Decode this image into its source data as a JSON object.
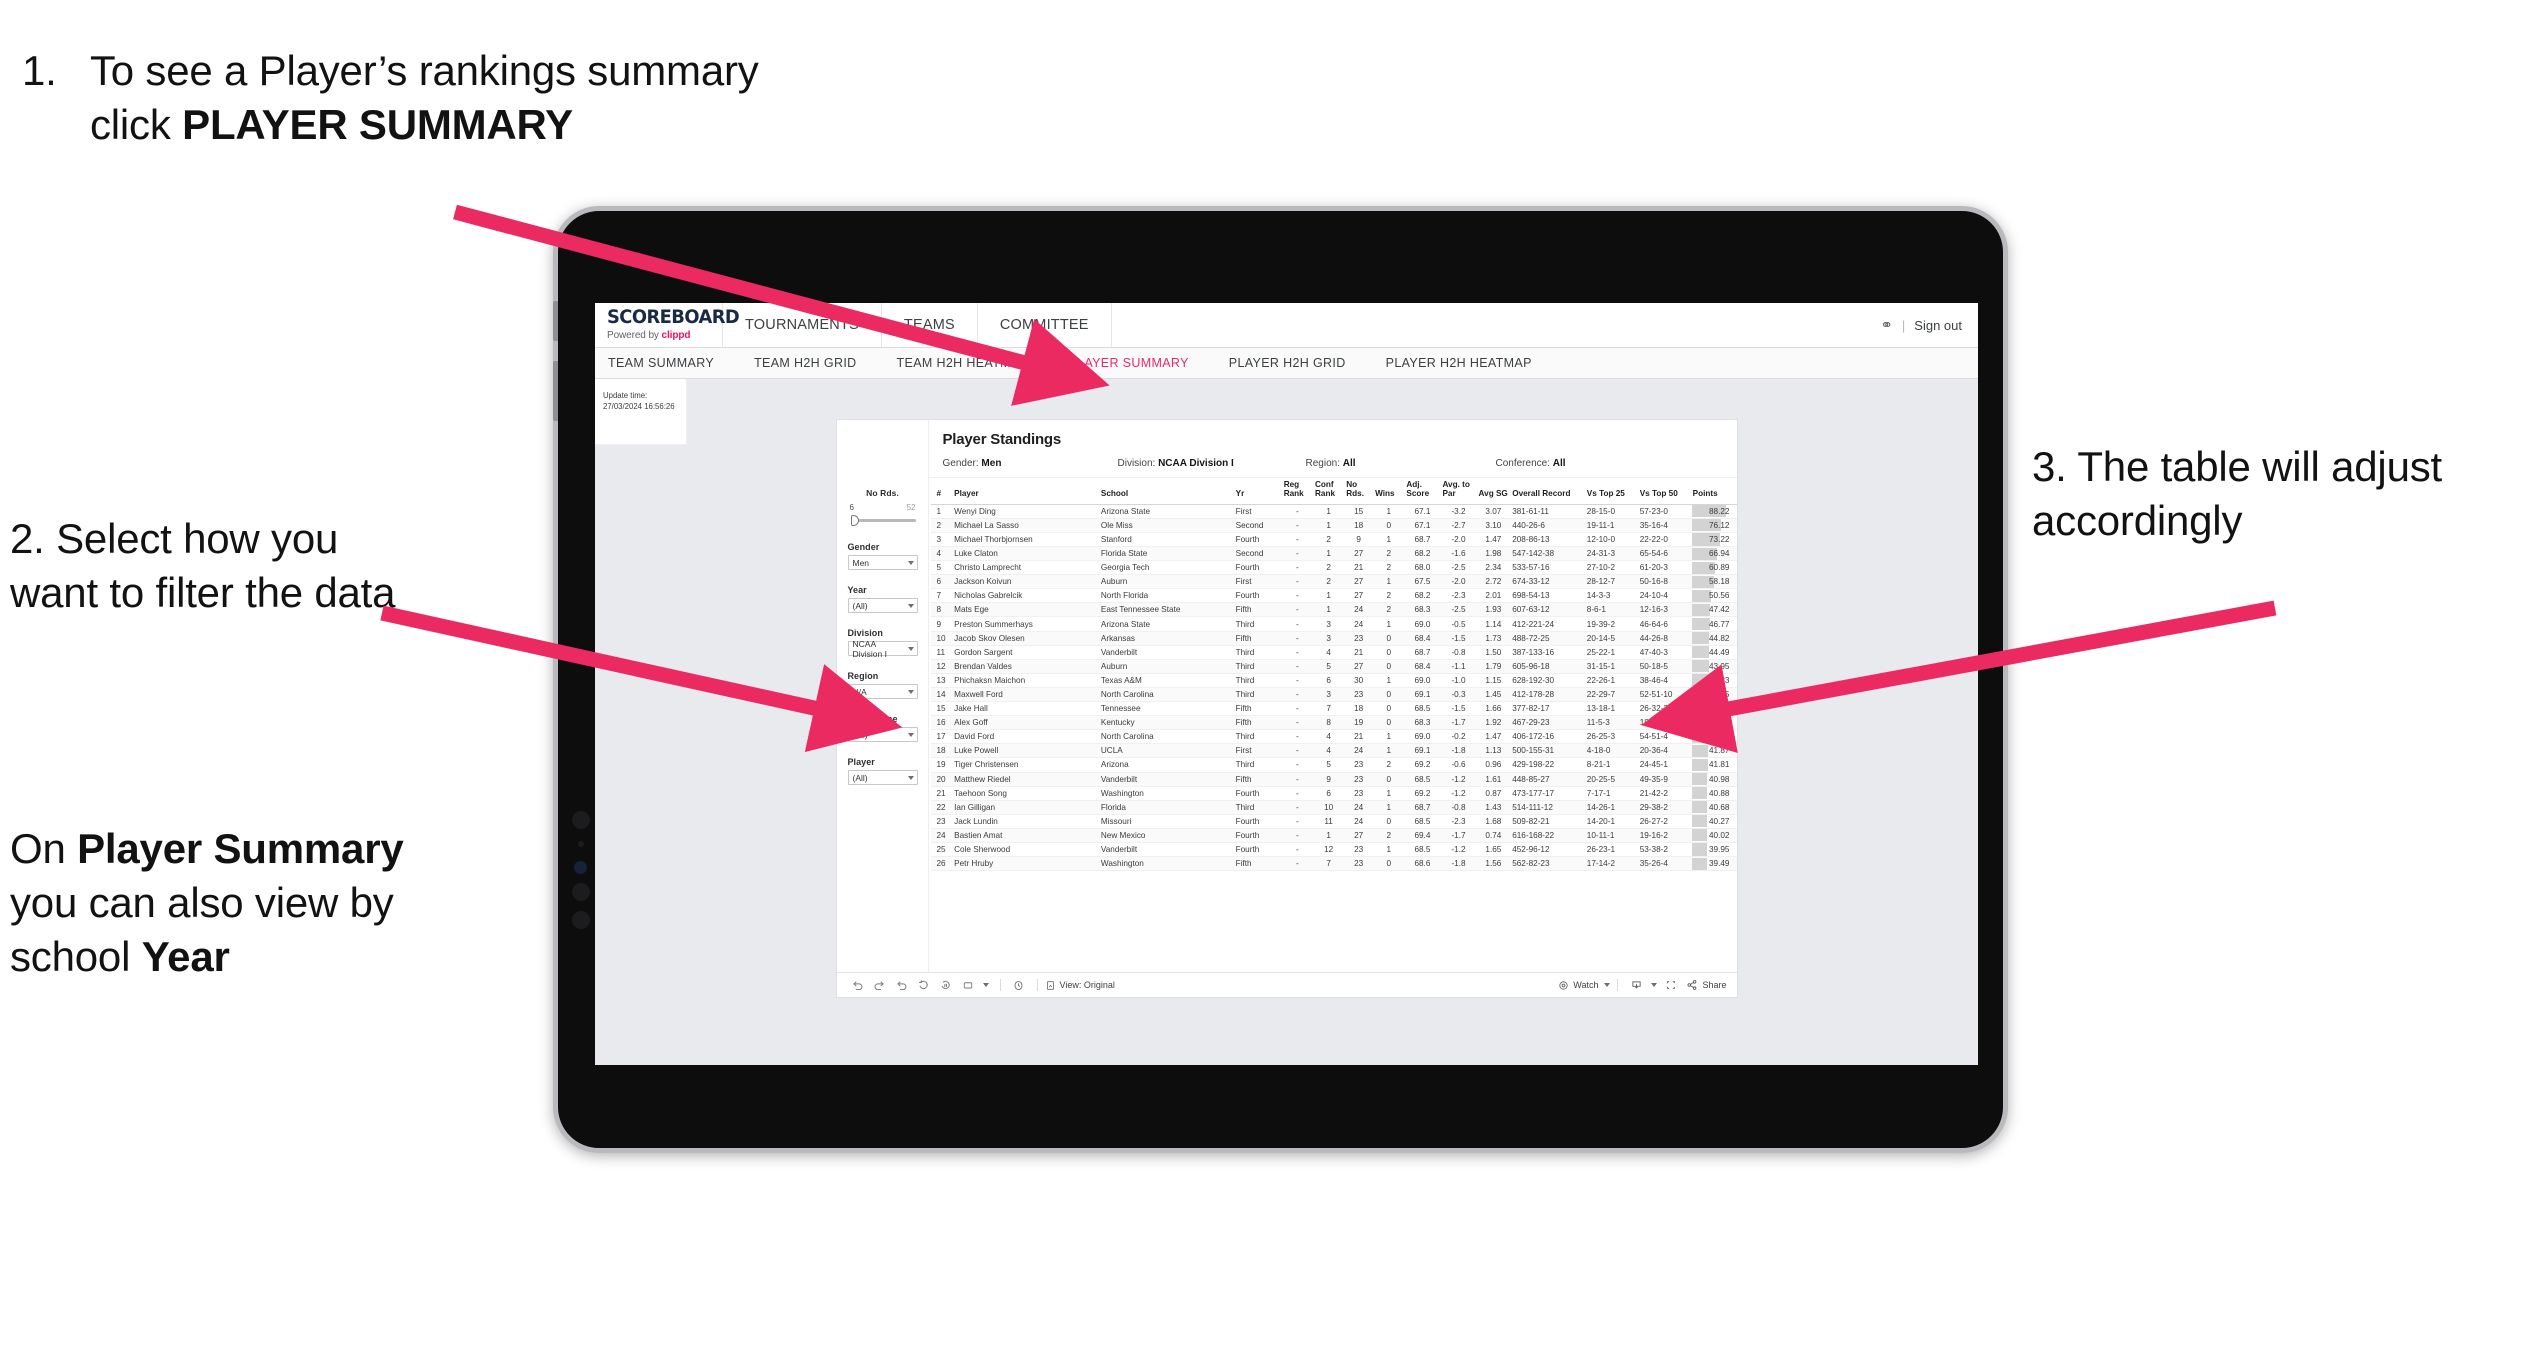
{
  "annotations": {
    "step1": {
      "number": "1.",
      "text_before": "To see a Player’s rankings summary click ",
      "bold": "PLAYER SUMMARY"
    },
    "step2": {
      "text": "2. Select how you want to filter the data"
    },
    "step2b": {
      "pre": "On ",
      "bold1": "Player Summary",
      "mid": " you can also view by school ",
      "bold2": "Year"
    },
    "step3": {
      "text": "3. The table will adjust accordingly"
    },
    "arrow_color": "#ec2a62"
  },
  "app": {
    "logo": {
      "main": "SCOREBOARD",
      "powered": "Powered by",
      "brand": "clippd"
    },
    "top_nav": [
      "TOURNAMENTS",
      "TEAMS",
      "COMMITTEE"
    ],
    "account_icon": "person-icon",
    "divider": "|",
    "sign_out": "Sign out",
    "sub_nav": [
      {
        "label": "TEAM SUMMARY",
        "active": false
      },
      {
        "label": "TEAM H2H GRID",
        "active": false
      },
      {
        "label": "TEAM H2H HEATMAP",
        "active": false
      },
      {
        "label": "PLAYER SUMMARY",
        "active": true
      },
      {
        "label": "PLAYER H2H GRID",
        "active": false
      },
      {
        "label": "PLAYER H2H HEATMAP",
        "active": false
      }
    ],
    "active_tab_color": "#ea2a68"
  },
  "viz": {
    "update_time_label": "Update time:",
    "update_time_value": "27/03/2024 16:56:26",
    "title": "Player Standings",
    "meta": [
      {
        "label": "Gender:",
        "value": "Men"
      },
      {
        "label": "Division:",
        "value": "NCAA Division I"
      },
      {
        "label": "Region:",
        "value": "All"
      },
      {
        "label": "Conference:",
        "value": "All"
      }
    ],
    "filters": {
      "slider": {
        "label": "No Rds.",
        "min": "6",
        "max": "52"
      },
      "selects": [
        {
          "label": "Gender",
          "value": "Men"
        },
        {
          "label": "Year",
          "value": "(All)"
        },
        {
          "label": "Division",
          "value": "NCAA Division I"
        },
        {
          "label": "Region",
          "value": "N/A"
        },
        {
          "label": "Conference",
          "value": "(All)"
        },
        {
          "label": "Player",
          "value": "(All)"
        }
      ]
    },
    "toolbar": {
      "undo_icon": "undo-icon",
      "redo_icon": "redo-icon",
      "revert_icon": "revert-icon",
      "refresh_icon": "refresh-icon",
      "pause_icon": "pause-icon",
      "device_icon": "device-icon",
      "history_icon": "history-icon",
      "view_label": "View: Original",
      "watch_label": "Watch",
      "download_icon": "download-icon",
      "fullscreen_icon": "fullscreen-icon",
      "share_label": "Share"
    }
  },
  "table": {
    "columns": [
      {
        "key": "rank",
        "label": "#"
      },
      {
        "key": "player",
        "label": "Player"
      },
      {
        "key": "school",
        "label": "School"
      },
      {
        "key": "yr",
        "label": "Yr"
      },
      {
        "key": "reg_rank",
        "label": "Reg Rank"
      },
      {
        "key": "conf_rank",
        "label": "Conf Rank"
      },
      {
        "key": "no_rds",
        "label": "No Rds."
      },
      {
        "key": "wins",
        "label": "Wins"
      },
      {
        "key": "adj_score",
        "label": "Adj. Score"
      },
      {
        "key": "avg_to_par",
        "label": "Avg. to Par"
      },
      {
        "key": "avg_sg",
        "label": "Avg SG"
      },
      {
        "key": "overall_record",
        "label": "Overall Record"
      },
      {
        "key": "vs_top_25",
        "label": "Vs Top 25"
      },
      {
        "key": "vs_top_50",
        "label": "Vs Top 50"
      },
      {
        "key": "points",
        "label": "Points"
      }
    ],
    "points_max": 88.22,
    "rows": [
      {
        "rank": "1",
        "player": "Wenyi Ding",
        "school": "Arizona State",
        "yr": "First",
        "reg_rank": "-",
        "conf_rank": "1",
        "no_rds": "15",
        "wins": "1",
        "adj_score": "67.1",
        "avg_to_par": "-3.2",
        "avg_sg": "3.07",
        "overall_record": "381-61-11",
        "vs_top_25": "28-15-0",
        "vs_top_50": "57-23-0",
        "points": "88.22"
      },
      {
        "rank": "2",
        "player": "Michael La Sasso",
        "school": "Ole Miss",
        "yr": "Second",
        "reg_rank": "-",
        "conf_rank": "1",
        "no_rds": "18",
        "wins": "0",
        "adj_score": "67.1",
        "avg_to_par": "-2.7",
        "avg_sg": "3.10",
        "overall_record": "440-26-6",
        "vs_top_25": "19-11-1",
        "vs_top_50": "35-16-4",
        "points": "76.12"
      },
      {
        "rank": "3",
        "player": "Michael Thorbjornsen",
        "school": "Stanford",
        "yr": "Fourth",
        "reg_rank": "-",
        "conf_rank": "2",
        "no_rds": "9",
        "wins": "1",
        "adj_score": "68.7",
        "avg_to_par": "-2.0",
        "avg_sg": "1.47",
        "overall_record": "208-86-13",
        "vs_top_25": "12-10-0",
        "vs_top_50": "22-22-0",
        "points": "73.22"
      },
      {
        "rank": "4",
        "player": "Luke Claton",
        "school": "Florida State",
        "yr": "Second",
        "reg_rank": "-",
        "conf_rank": "1",
        "no_rds": "27",
        "wins": "2",
        "adj_score": "68.2",
        "avg_to_par": "-1.6",
        "avg_sg": "1.98",
        "overall_record": "547-142-38",
        "vs_top_25": "24-31-3",
        "vs_top_50": "65-54-6",
        "points": "66.94"
      },
      {
        "rank": "5",
        "player": "Christo Lamprecht",
        "school": "Georgia Tech",
        "yr": "Fourth",
        "reg_rank": "-",
        "conf_rank": "2",
        "no_rds": "21",
        "wins": "2",
        "adj_score": "68.0",
        "avg_to_par": "-2.5",
        "avg_sg": "2.34",
        "overall_record": "533-57-16",
        "vs_top_25": "27-10-2",
        "vs_top_50": "61-20-3",
        "points": "60.89"
      },
      {
        "rank": "6",
        "player": "Jackson Koivun",
        "school": "Auburn",
        "yr": "First",
        "reg_rank": "-",
        "conf_rank": "2",
        "no_rds": "27",
        "wins": "1",
        "adj_score": "67.5",
        "avg_to_par": "-2.0",
        "avg_sg": "2.72",
        "overall_record": "674-33-12",
        "vs_top_25": "28-12-7",
        "vs_top_50": "50-16-8",
        "points": "58.18"
      },
      {
        "rank": "7",
        "player": "Nicholas Gabrelcik",
        "school": "North Florida",
        "yr": "Fourth",
        "reg_rank": "-",
        "conf_rank": "1",
        "no_rds": "27",
        "wins": "2",
        "adj_score": "68.2",
        "avg_to_par": "-2.3",
        "avg_sg": "2.01",
        "overall_record": "698-54-13",
        "vs_top_25": "14-3-3",
        "vs_top_50": "24-10-4",
        "points": "50.56"
      },
      {
        "rank": "8",
        "player": "Mats Ege",
        "school": "East Tennessee State",
        "yr": "Fifth",
        "reg_rank": "-",
        "conf_rank": "1",
        "no_rds": "24",
        "wins": "2",
        "adj_score": "68.3",
        "avg_to_par": "-2.5",
        "avg_sg": "1.93",
        "overall_record": "607-63-12",
        "vs_top_25": "8-6-1",
        "vs_top_50": "12-16-3",
        "points": "47.42"
      },
      {
        "rank": "9",
        "player": "Preston Summerhays",
        "school": "Arizona State",
        "yr": "Third",
        "reg_rank": "-",
        "conf_rank": "3",
        "no_rds": "24",
        "wins": "1",
        "adj_score": "69.0",
        "avg_to_par": "-0.5",
        "avg_sg": "1.14",
        "overall_record": "412-221-24",
        "vs_top_25": "19-39-2",
        "vs_top_50": "46-64-6",
        "points": "46.77"
      },
      {
        "rank": "10",
        "player": "Jacob Skov Olesen",
        "school": "Arkansas",
        "yr": "Fifth",
        "reg_rank": "-",
        "conf_rank": "3",
        "no_rds": "23",
        "wins": "0",
        "adj_score": "68.4",
        "avg_to_par": "-1.5",
        "avg_sg": "1.73",
        "overall_record": "488-72-25",
        "vs_top_25": "20-14-5",
        "vs_top_50": "44-26-8",
        "points": "44.82"
      },
      {
        "rank": "11",
        "player": "Gordon Sargent",
        "school": "Vanderbilt",
        "yr": "Third",
        "reg_rank": "-",
        "conf_rank": "4",
        "no_rds": "21",
        "wins": "0",
        "adj_score": "68.7",
        "avg_to_par": "-0.8",
        "avg_sg": "1.50",
        "overall_record": "387-133-16",
        "vs_top_25": "25-22-1",
        "vs_top_50": "47-40-3",
        "points": "44.49"
      },
      {
        "rank": "12",
        "player": "Brendan Valdes",
        "school": "Auburn",
        "yr": "Third",
        "reg_rank": "-",
        "conf_rank": "5",
        "no_rds": "27",
        "wins": "0",
        "adj_score": "68.4",
        "avg_to_par": "-1.1",
        "avg_sg": "1.79",
        "overall_record": "605-96-18",
        "vs_top_25": "31-15-1",
        "vs_top_50": "50-18-5",
        "points": "43.95"
      },
      {
        "rank": "13",
        "player": "Phichaksn Maichon",
        "school": "Texas A&M",
        "yr": "Third",
        "reg_rank": "-",
        "conf_rank": "6",
        "no_rds": "30",
        "wins": "1",
        "adj_score": "69.0",
        "avg_to_par": "-1.0",
        "avg_sg": "1.15",
        "overall_record": "628-192-30",
        "vs_top_25": "22-26-1",
        "vs_top_50": "38-46-4",
        "points": "43.83"
      },
      {
        "rank": "14",
        "player": "Maxwell Ford",
        "school": "North Carolina",
        "yr": "Third",
        "reg_rank": "-",
        "conf_rank": "3",
        "no_rds": "23",
        "wins": "0",
        "adj_score": "69.1",
        "avg_to_par": "-0.3",
        "avg_sg": "1.45",
        "overall_record": "412-178-28",
        "vs_top_25": "22-29-7",
        "vs_top_50": "52-51-10",
        "points": "42.75"
      },
      {
        "rank": "15",
        "player": "Jake Hall",
        "school": "Tennessee",
        "yr": "Fifth",
        "reg_rank": "-",
        "conf_rank": "7",
        "no_rds": "18",
        "wins": "0",
        "adj_score": "68.5",
        "avg_to_par": "-1.5",
        "avg_sg": "1.66",
        "overall_record": "377-82-17",
        "vs_top_25": "13-18-1",
        "vs_top_50": "26-32-2",
        "points": "42.55"
      },
      {
        "rank": "16",
        "player": "Alex Goff",
        "school": "Kentucky",
        "yr": "Fifth",
        "reg_rank": "-",
        "conf_rank": "8",
        "no_rds": "19",
        "wins": "0",
        "adj_score": "68.3",
        "avg_to_par": "-1.7",
        "avg_sg": "1.92",
        "overall_record": "467-29-23",
        "vs_top_25": "11-5-3",
        "vs_top_50": "18-7-3",
        "points": "42.54"
      },
      {
        "rank": "17",
        "player": "David Ford",
        "school": "North Carolina",
        "yr": "Third",
        "reg_rank": "-",
        "conf_rank": "4",
        "no_rds": "21",
        "wins": "1",
        "adj_score": "69.0",
        "avg_to_par": "-0.2",
        "avg_sg": "1.47",
        "overall_record": "406-172-16",
        "vs_top_25": "26-25-3",
        "vs_top_50": "54-51-4",
        "points": "42.35"
      },
      {
        "rank": "18",
        "player": "Luke Powell",
        "school": "UCLA",
        "yr": "First",
        "reg_rank": "-",
        "conf_rank": "4",
        "no_rds": "24",
        "wins": "1",
        "adj_score": "69.1",
        "avg_to_par": "-1.8",
        "avg_sg": "1.13",
        "overall_record": "500-155-31",
        "vs_top_25": "4-18-0",
        "vs_top_50": "20-36-4",
        "points": "41.87"
      },
      {
        "rank": "19",
        "player": "Tiger Christensen",
        "school": "Arizona",
        "yr": "Third",
        "reg_rank": "-",
        "conf_rank": "5",
        "no_rds": "23",
        "wins": "2",
        "adj_score": "69.2",
        "avg_to_par": "-0.6",
        "avg_sg": "0.96",
        "overall_record": "429-198-22",
        "vs_top_25": "8-21-1",
        "vs_top_50": "24-45-1",
        "points": "41.81"
      },
      {
        "rank": "20",
        "player": "Matthew Riedel",
        "school": "Vanderbilt",
        "yr": "Fifth",
        "reg_rank": "-",
        "conf_rank": "9",
        "no_rds": "23",
        "wins": "0",
        "adj_score": "68.5",
        "avg_to_par": "-1.2",
        "avg_sg": "1.61",
        "overall_record": "448-85-27",
        "vs_top_25": "20-25-5",
        "vs_top_50": "49-35-9",
        "points": "40.98"
      },
      {
        "rank": "21",
        "player": "Taehoon Song",
        "school": "Washington",
        "yr": "Fourth",
        "reg_rank": "-",
        "conf_rank": "6",
        "no_rds": "23",
        "wins": "1",
        "adj_score": "69.2",
        "avg_to_par": "-1.2",
        "avg_sg": "0.87",
        "overall_record": "473-177-17",
        "vs_top_25": "7-17-1",
        "vs_top_50": "21-42-2",
        "points": "40.88"
      },
      {
        "rank": "22",
        "player": "Ian Gilligan",
        "school": "Florida",
        "yr": "Third",
        "reg_rank": "-",
        "conf_rank": "10",
        "no_rds": "24",
        "wins": "1",
        "adj_score": "68.7",
        "avg_to_par": "-0.8",
        "avg_sg": "1.43",
        "overall_record": "514-111-12",
        "vs_top_25": "14-26-1",
        "vs_top_50": "29-38-2",
        "points": "40.68"
      },
      {
        "rank": "23",
        "player": "Jack Lundin",
        "school": "Missouri",
        "yr": "Fourth",
        "reg_rank": "-",
        "conf_rank": "11",
        "no_rds": "24",
        "wins": "0",
        "adj_score": "68.5",
        "avg_to_par": "-2.3",
        "avg_sg": "1.68",
        "overall_record": "509-82-21",
        "vs_top_25": "14-20-1",
        "vs_top_50": "26-27-2",
        "points": "40.27"
      },
      {
        "rank": "24",
        "player": "Bastien Amat",
        "school": "New Mexico",
        "yr": "Fourth",
        "reg_rank": "-",
        "conf_rank": "1",
        "no_rds": "27",
        "wins": "2",
        "adj_score": "69.4",
        "avg_to_par": "-1.7",
        "avg_sg": "0.74",
        "overall_record": "616-168-22",
        "vs_top_25": "10-11-1",
        "vs_top_50": "19-16-2",
        "points": "40.02"
      },
      {
        "rank": "25",
        "player": "Cole Sherwood",
        "school": "Vanderbilt",
        "yr": "Fourth",
        "reg_rank": "-",
        "conf_rank": "12",
        "no_rds": "23",
        "wins": "1",
        "adj_score": "68.5",
        "avg_to_par": "-1.2",
        "avg_sg": "1.65",
        "overall_record": "452-96-12",
        "vs_top_25": "26-23-1",
        "vs_top_50": "53-38-2",
        "points": "39.95"
      },
      {
        "rank": "26",
        "player": "Petr Hruby",
        "school": "Washington",
        "yr": "Fifth",
        "reg_rank": "-",
        "conf_rank": "7",
        "no_rds": "23",
        "wins": "0",
        "adj_score": "68.6",
        "avg_to_par": "-1.8",
        "avg_sg": "1.56",
        "overall_record": "562-82-23",
        "vs_top_25": "17-14-2",
        "vs_top_50": "35-26-4",
        "points": "39.49"
      }
    ]
  }
}
